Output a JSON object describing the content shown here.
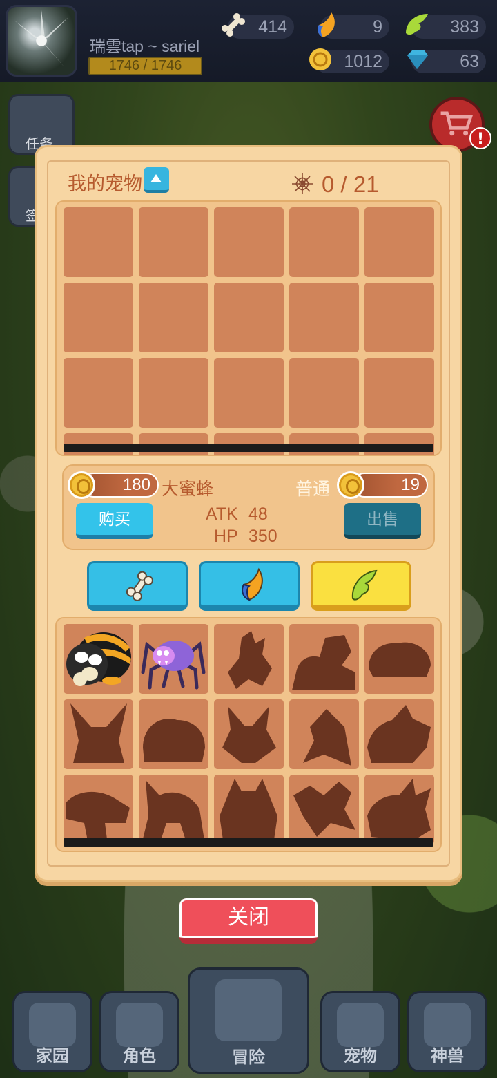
{
  "hud": {
    "player_name": "瑞雲tap ~ sariel",
    "hp": "1746 / 1746",
    "resources": [
      {
        "name": "bone-icon",
        "value": "414"
      },
      {
        "name": "claw-icon",
        "value": "9"
      },
      {
        "name": "wing-icon",
        "value": "383"
      },
      {
        "name": "gold-coin-icon",
        "value": "1012"
      },
      {
        "name": "gem-icon",
        "value": "63"
      }
    ]
  },
  "side": {
    "task_label": "任务",
    "sign_label": "签"
  },
  "panel": {
    "title": "我的宠物",
    "capacity": "0 / 21"
  },
  "selected_pet": {
    "buy_price": "180",
    "name": "大蜜蜂",
    "rarity": "普通",
    "sell_price": "19",
    "atk_label": "ATK",
    "atk_value": "48",
    "hp_label": "HP",
    "hp_value": "350",
    "buy_label": "购买",
    "sell_label": "出售"
  },
  "tabs": [
    {
      "icon": "bone-icon",
      "active": false
    },
    {
      "icon": "claw-icon",
      "active": false
    },
    {
      "icon": "wing-icon",
      "active": true
    }
  ],
  "close_label": "关闭",
  "nav": {
    "home": "家园",
    "role": "角色",
    "adventure": "冒险",
    "pets": "宠物",
    "beast": "神兽"
  },
  "colors": {
    "panel": "#f7d6a3",
    "slot": "#d0845a",
    "accent_text": "#b65a2e",
    "button_blue": "#33c3ea",
    "close_red": "#ef4f5a",
    "tab_active": "#fae040"
  }
}
